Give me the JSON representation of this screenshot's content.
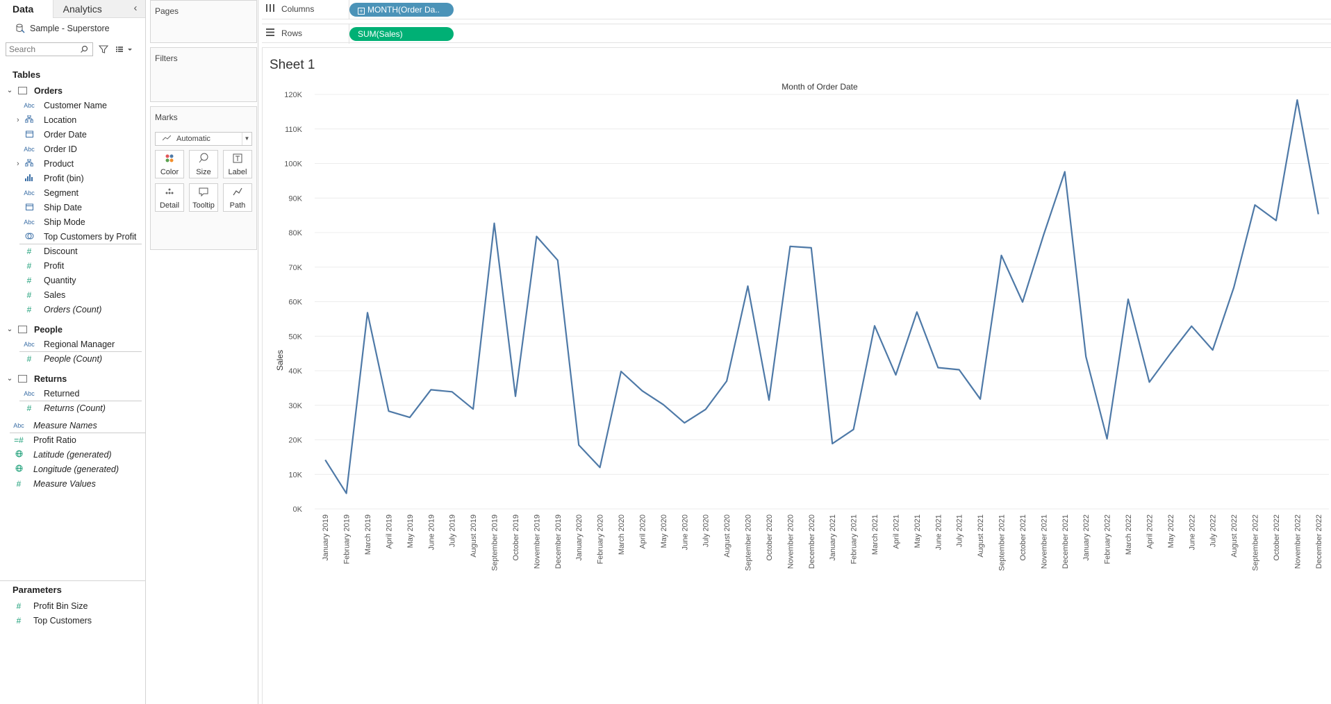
{
  "pane": {
    "tab_data": "Data",
    "tab_analytics": "Analytics",
    "datasource": "Sample - Superstore",
    "search_placeholder": "Search",
    "tables_title": "Tables",
    "parameters_title": "Parameters",
    "orders": {
      "name": "Orders",
      "fields": [
        {
          "icon": "Abc",
          "label": "Customer Name"
        },
        {
          "icon": "hier",
          "label": "Location"
        },
        {
          "icon": "date",
          "label": "Order Date"
        },
        {
          "icon": "Abc",
          "label": "Order ID"
        },
        {
          "icon": "hier",
          "label": "Product"
        },
        {
          "icon": "bin",
          "label": "Profit (bin)"
        },
        {
          "icon": "Abc",
          "label": "Segment"
        },
        {
          "icon": "date",
          "label": "Ship Date"
        },
        {
          "icon": "Abc",
          "label": "Ship Mode"
        },
        {
          "icon": "set",
          "label": "Top Customers by Profit"
        }
      ],
      "measures": [
        "Discount",
        "Profit",
        "Quantity",
        "Sales",
        "Orders (Count)"
      ]
    },
    "people": {
      "name": "People",
      "field": "Regional Manager",
      "count": "People (Count)"
    },
    "returns": {
      "name": "Returns",
      "field": "Returned",
      "count": "Returns (Count)"
    },
    "global_fields": [
      "Measure Names",
      "Profit Ratio",
      "Latitude (generated)",
      "Longitude (generated)",
      "Measure Values"
    ],
    "parameters": [
      "Profit Bin Size",
      "Top Customers"
    ],
    "icon_abc": "Abc"
  },
  "cards": {
    "pages": "Pages",
    "filters": "Filters",
    "marks": "Marks",
    "mark_type": "Automatic",
    "buttons": [
      "Color",
      "Size",
      "Label",
      "Detail",
      "Tooltip",
      "Path"
    ]
  },
  "shelves": {
    "columns_label": "Columns",
    "columns_pill": "MONTH(Order Da..",
    "rows_label": "Rows",
    "rows_pill": "SUM(Sales)"
  },
  "sheet": {
    "title": "Sheet 1"
  },
  "chart_data": {
    "type": "line",
    "title": "Month of Order Date",
    "xlabel": "",
    "ylabel": "Sales",
    "ylim": [
      0,
      120000
    ],
    "yticks": [
      "0K",
      "10K",
      "20K",
      "30K",
      "40K",
      "50K",
      "60K",
      "70K",
      "80K",
      "90K",
      "100K",
      "110K",
      "120K"
    ],
    "line_color": "#4e79a7",
    "categories": [
      "January 2019",
      "February 2019",
      "March 2019",
      "April 2019",
      "May 2019",
      "June 2019",
      "July 2019",
      "August 2019",
      "September 2019",
      "October 2019",
      "November 2019",
      "December 2019",
      "January 2020",
      "February 2020",
      "March 2020",
      "April 2020",
      "May 2020",
      "June 2020",
      "July 2020",
      "August 2020",
      "September 2020",
      "October 2020",
      "November 2020",
      "December 2020",
      "January 2021",
      "February 2021",
      "March 2021",
      "April 2021",
      "May 2021",
      "June 2021",
      "July 2021",
      "August 2021",
      "September 2021",
      "October 2021",
      "November 2021",
      "December 2021",
      "January 2022",
      "February 2022",
      "March 2022",
      "April 2022",
      "May 2022",
      "June 2022",
      "July 2022",
      "August 2022",
      "September 2022",
      "October 2022",
      "November 2022",
      "December 2022"
    ],
    "values": [
      14200,
      4500,
      56800,
      28300,
      26500,
      34500,
      33900,
      28900,
      82700,
      32600,
      78900,
      72000,
      18500,
      12000,
      39800,
      34200,
      30200,
      24900,
      28800,
      37000,
      64500,
      31500,
      76000,
      75600,
      18900,
      23000,
      53000,
      38800,
      57000,
      40900,
      40300,
      31800,
      73400,
      59900,
      79400,
      97600,
      44100,
      20300,
      60700,
      36700,
      45000,
      52900,
      46000,
      64100,
      88000,
      83500,
      118400,
      85300
    ]
  }
}
